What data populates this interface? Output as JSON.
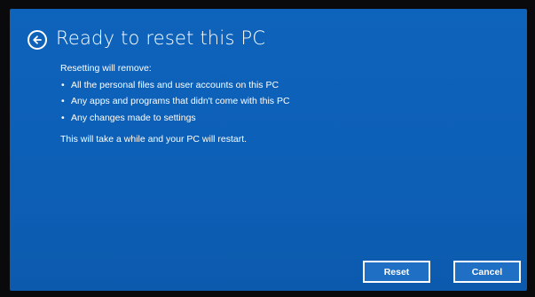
{
  "dialog": {
    "title": "Ready to reset this PC",
    "intro": "Resetting will remove:",
    "bullets": [
      "All the personal files and user accounts on this PC",
      "Any apps and programs that didn't come with this PC",
      "Any changes made to settings"
    ],
    "note": "This will take a while and your PC will restart.",
    "buttons": {
      "reset_label": "Reset",
      "cancel_label": "Cancel"
    },
    "back_icon": "back-arrow-icon"
  },
  "colors": {
    "background": "#0f61b8",
    "text": "#ffffff",
    "frame": "#0a0a0c"
  }
}
